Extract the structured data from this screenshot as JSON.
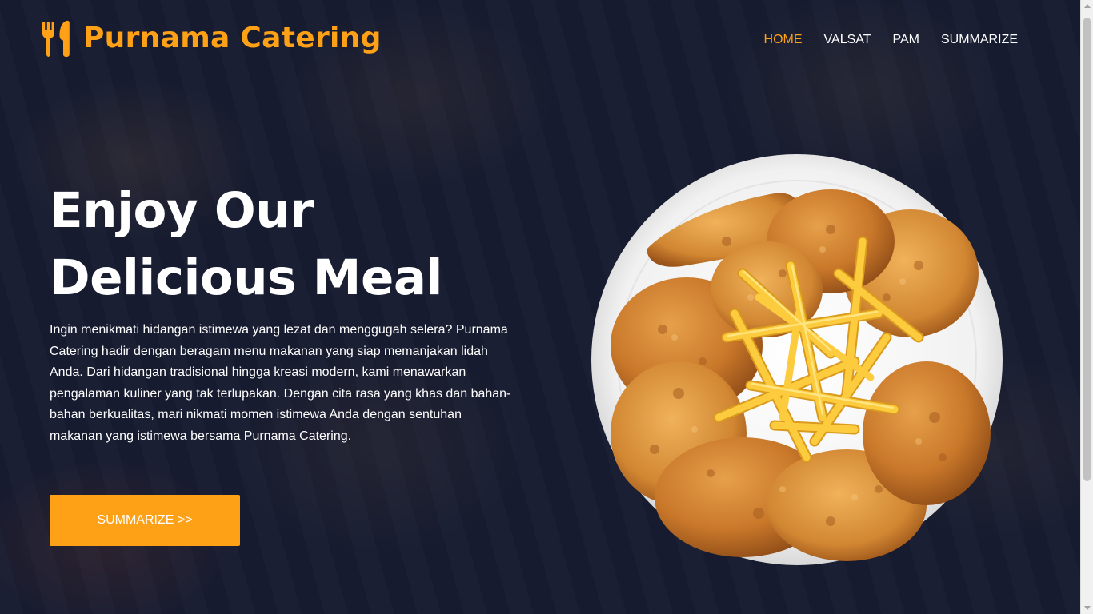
{
  "brand": {
    "name": "Purnama Catering",
    "icon": "utensils-icon",
    "color": "#fea116"
  },
  "nav": {
    "items": [
      {
        "label": "HOME",
        "active": true
      },
      {
        "label": "VALSAT",
        "active": false
      },
      {
        "label": "PAM",
        "active": false
      },
      {
        "label": "SUMMARIZE",
        "active": false
      }
    ]
  },
  "hero": {
    "title_line1": "Enjoy Our",
    "title_line2": "Delicious Meal",
    "description": "Ingin menikmati hidangan istimewa yang lezat dan menggugah selera? Purnama Catering hadir dengan beragam menu makanan yang siap memanjakan lidah Anda. Dari hidangan tradisional hingga kreasi modern, kami menawarkan pengalaman kuliner yang tak terlupakan. Dengan cita rasa yang khas dan bahan-bahan berkualitas, mari nikmati momen istimewa Anda dengan sentuhan makanan yang istimewa bersama Purnama Catering.",
    "cta_label": "SUMMARIZE >>",
    "image": "fried-chicken-fries-plate"
  },
  "colors": {
    "accent": "#fea116",
    "background": "#1b2136",
    "text": "#ffffff"
  }
}
